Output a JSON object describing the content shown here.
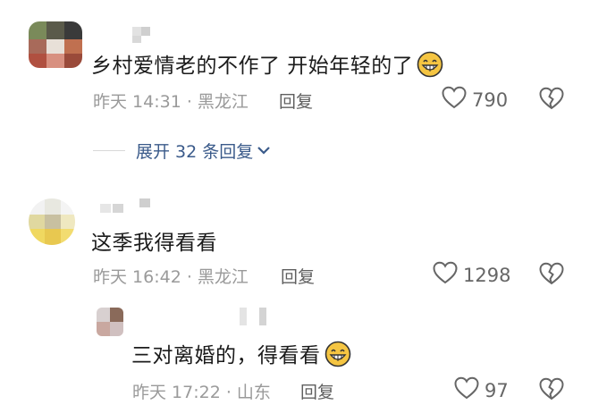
{
  "comments": [
    {
      "text": "乡村爱情老的不作了  开始年轻的了",
      "emoji": "grinning-emoji",
      "meta": "昨天 14:31 · 黑龙江",
      "reply_label": "回复",
      "likes": "790",
      "expand_label": "展开 32 条回复"
    },
    {
      "text": "这季我得看看",
      "meta": "昨天 16:42 · 黑龙江",
      "reply_label": "回复",
      "likes": "1298",
      "replies": [
        {
          "text": "三对离婚的，得看看",
          "emoji": "grinning-emoji",
          "meta": "昨天 17:22 · 山东",
          "reply_label": "回复",
          "likes": "97"
        }
      ]
    }
  ],
  "colors": {
    "link": "#3a5a8a",
    "meta": "#9a9a9a",
    "emoji_fill": "#f5c542"
  }
}
